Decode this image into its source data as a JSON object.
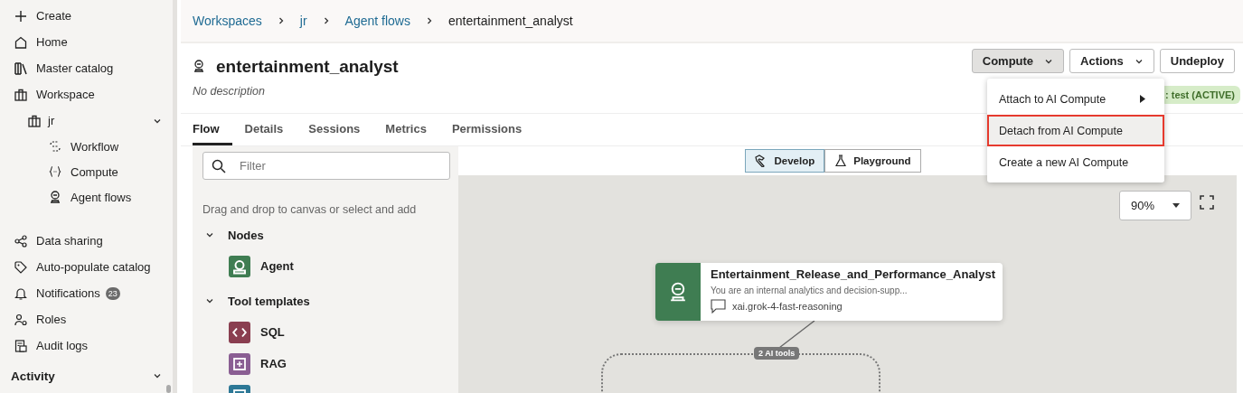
{
  "sidebar": {
    "items": [
      {
        "label": "Create"
      },
      {
        "label": "Home"
      },
      {
        "label": "Master catalog"
      },
      {
        "label": "Workspace",
        "children": [
          {
            "label": "jr",
            "expanded": true,
            "children": [
              {
                "label": "Workflow"
              },
              {
                "label": "Compute"
              },
              {
                "label": "Agent flows"
              }
            ]
          }
        ]
      },
      {
        "label": "Data sharing"
      },
      {
        "label": "Auto-populate catalog"
      },
      {
        "label": "Notifications",
        "badge": "23"
      },
      {
        "label": "Roles"
      },
      {
        "label": "Audit logs"
      }
    ],
    "section": {
      "label": "Activity",
      "expanded": true
    }
  },
  "breadcrumbs": [
    {
      "label": "Workspaces",
      "link": true
    },
    {
      "label": "jr",
      "link": true
    },
    {
      "label": "Agent flows",
      "link": true
    },
    {
      "label": "entertainment_analyst",
      "link": false
    }
  ],
  "header": {
    "title": "entertainment_analyst",
    "description": "No description",
    "buttons": [
      {
        "label": "Compute",
        "dropdown": true,
        "open": true
      },
      {
        "label": "Actions",
        "dropdown": true,
        "open": false
      },
      {
        "label": "Undeploy",
        "dropdown": false,
        "open": false
      }
    ],
    "status_badge": ": test (ACTIVE)"
  },
  "compute_menu": [
    {
      "label": "Attach to AI Compute",
      "submenu": true,
      "highlighted": false
    },
    {
      "label": "Detach from AI Compute",
      "submenu": false,
      "highlighted": true
    },
    {
      "label": "Create a new AI Compute",
      "submenu": false,
      "highlighted": false
    }
  ],
  "tabs": [
    {
      "label": "Flow",
      "selected": true
    },
    {
      "label": "Details",
      "selected": false
    },
    {
      "label": "Sessions",
      "selected": false
    },
    {
      "label": "Metrics",
      "selected": false
    },
    {
      "label": "Permissions",
      "selected": false
    }
  ],
  "palette": {
    "filter": {
      "placeholder": "Filter"
    },
    "hint": "Drag and drop to canvas or select and add",
    "groups": [
      {
        "label": "Nodes",
        "expanded": true,
        "items": [
          {
            "label": "Agent",
            "color": "#3f7d52"
          }
        ]
      },
      {
        "label": "Tool templates",
        "expanded": true,
        "items": [
          {
            "label": "SQL",
            "color": "#8a3e50"
          },
          {
            "label": "RAG",
            "color": "#8a5e93"
          },
          {
            "color": "#2d7896"
          }
        ]
      }
    ]
  },
  "modes": [
    {
      "label": "Develop",
      "selected": true
    },
    {
      "label": "Playground",
      "selected": false
    }
  ],
  "zoom": {
    "value": "90%"
  },
  "canvas": {
    "node": {
      "title": "Entertainment_Release_and_Performance_Analyst",
      "description": "You are an internal analytics and decision-supp...",
      "model": "xai.grok-4-fast-reasoning"
    },
    "connector_label": "2 AI tools"
  }
}
